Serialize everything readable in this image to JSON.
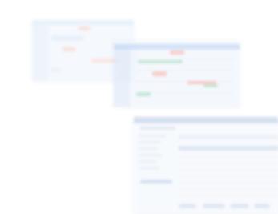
{
  "windows": [
    {
      "name": "window-1",
      "role": "blurred-window"
    },
    {
      "name": "window-2",
      "role": "blurred-calendar-window"
    },
    {
      "name": "window-3",
      "role": "blurred-table-window"
    }
  ],
  "colors": {
    "background": "#ffffff",
    "accent_blue": "#b7d1f2",
    "accent_red": "#f5b0a8",
    "accent_green": "#9fd9b8",
    "panel": "#eef4fd"
  }
}
